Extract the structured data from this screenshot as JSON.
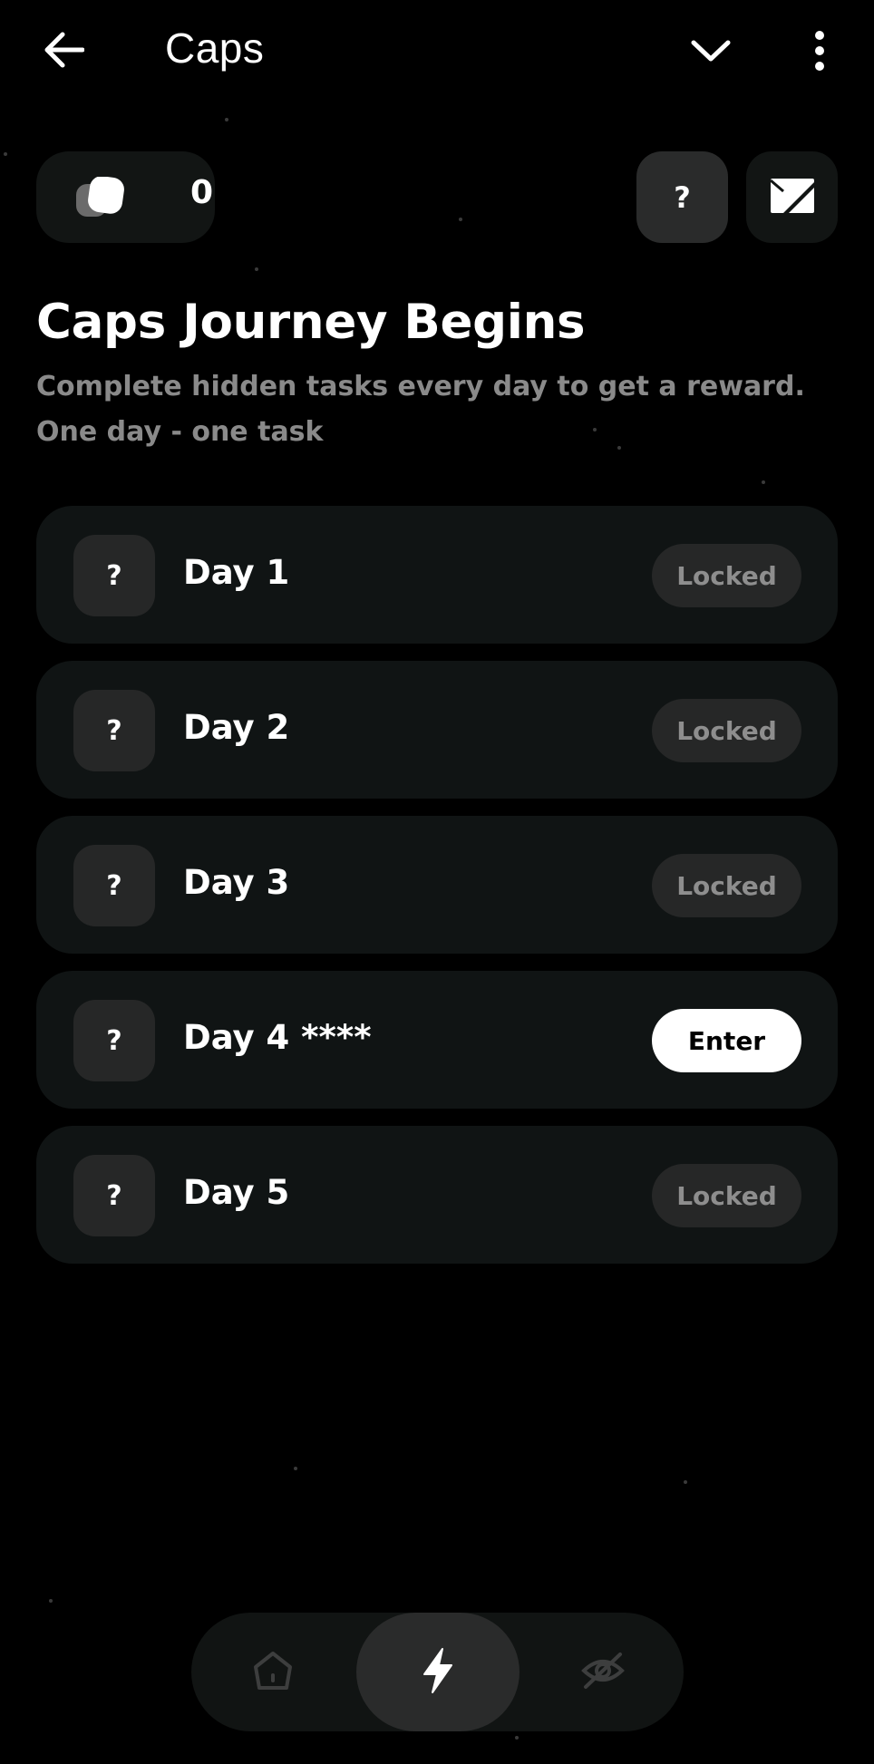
{
  "app_bar": {
    "title": "Caps",
    "back_icon": "arrow-left-icon",
    "dropdown_icon": "chevron-down-icon",
    "menu_icon": "more-vertical-icon"
  },
  "caps_counter": {
    "icon": "caps-icon",
    "count": "0"
  },
  "help_button": {
    "label": "?"
  },
  "media_button": {
    "icon": "media-icon"
  },
  "heading": {
    "title": "Caps Journey Begins",
    "subtitle": "Complete hidden tasks every day to get a reward. One day - one task"
  },
  "days": [
    {
      "badge": "?",
      "label": "Day 1",
      "status": "Locked"
    },
    {
      "badge": "?",
      "label": "Day 2",
      "status": "Locked"
    },
    {
      "badge": "?",
      "label": "Day 3",
      "status": "Locked"
    },
    {
      "badge": "?",
      "label": "Day 4 ****",
      "status": "Enter"
    },
    {
      "badge": "?",
      "label": "Day 5",
      "status": "Locked"
    }
  ],
  "bottom_nav": {
    "items": [
      {
        "icon": "home-icon",
        "active": false
      },
      {
        "icon": "lightning-icon",
        "active": true
      },
      {
        "icon": "eye-off-icon",
        "active": false
      }
    ]
  },
  "colors": {
    "background": "#000000",
    "card": "#101414",
    "chip": "#262727",
    "muted_text": "#8a8a8a",
    "enter_button": "#ffffff"
  }
}
